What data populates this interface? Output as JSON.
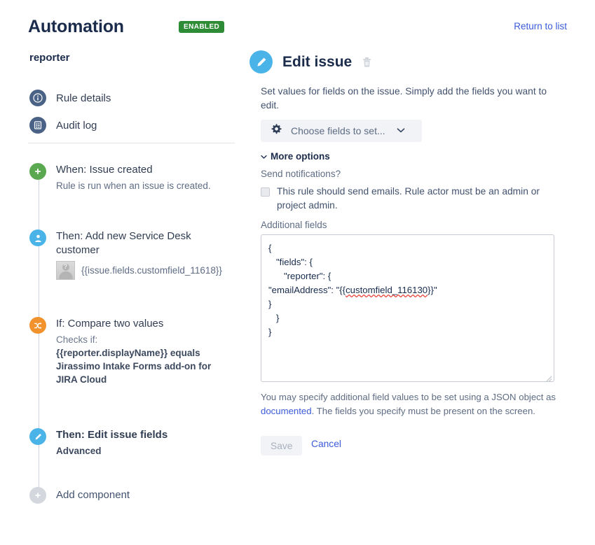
{
  "header": {
    "app_title": "Automation",
    "status_badge": "ENABLED",
    "return_link": "Return to list",
    "badge_color": "#2e8b36",
    "link_color": "#3b5bdb"
  },
  "sidebar": {
    "rule_name": "reporter",
    "nav": [
      {
        "label": "Rule details",
        "icon": "info-icon"
      },
      {
        "label": "Audit log",
        "icon": "list-document-icon"
      }
    ],
    "steps": [
      {
        "title": "When: Issue created",
        "subtitle": "Rule is run when an issue is created.",
        "icon": "plus-icon",
        "color": "#5aa84f"
      },
      {
        "title": "Then: Add new Service Desk customer",
        "avatar_text": "{{issue.fields.customfield_11618}}",
        "icon": "person-icon",
        "color": "#4ab3e8"
      },
      {
        "title": "If: Compare two values",
        "subtitle": "Checks if:",
        "detail": "{{reporter.displayName}} equals Jirassimo Intake Forms add-on for JIRA Cloud",
        "icon": "shuffle-icon",
        "color": "#f2922c"
      },
      {
        "title": "Then: Edit issue fields",
        "subtitle": "Advanced",
        "icon": "pencil-icon",
        "color": "#4ab3e8"
      },
      {
        "title": "Add component",
        "icon": "plus-icon",
        "color": "#d4d7dd"
      }
    ]
  },
  "main": {
    "title": "Edit issue",
    "delete_icon": "trash-icon",
    "description": "Set values for fields on the issue. Simply add the fields you want to edit.",
    "choose_fields": {
      "label": "Choose fields to set...",
      "icon": "gear-icon",
      "chevron": "chevron-down-icon"
    },
    "more_options_label": "More options",
    "send_notifications_label": "Send notifications?",
    "checkbox": {
      "label": "This rule should send emails. Rule actor must be an admin or project admin.",
      "checked": false
    },
    "additional_fields_label": "Additional fields",
    "json_value_lines": [
      "{",
      "   \"fields\": {",
      "      \"reporter\": {",
      "\"emailAddress\": \"{{customfield_116130}}\"",
      "}",
      "   }",
      "}"
    ],
    "json_value": "{\n   \"fields\": {\n      \"reporter\": {\n\"emailAddress\": \"{{customfield_116130}}\"\n}\n   }\n}",
    "json_spellcheck_token": "customfield_116130",
    "helper_text_before": "You may specify additional field values to be set using a JSON object as ",
    "helper_link": "documented",
    "helper_text_after": ". The fields you specify must be present on the screen.",
    "save_label": "Save",
    "cancel_label": "Cancel"
  }
}
